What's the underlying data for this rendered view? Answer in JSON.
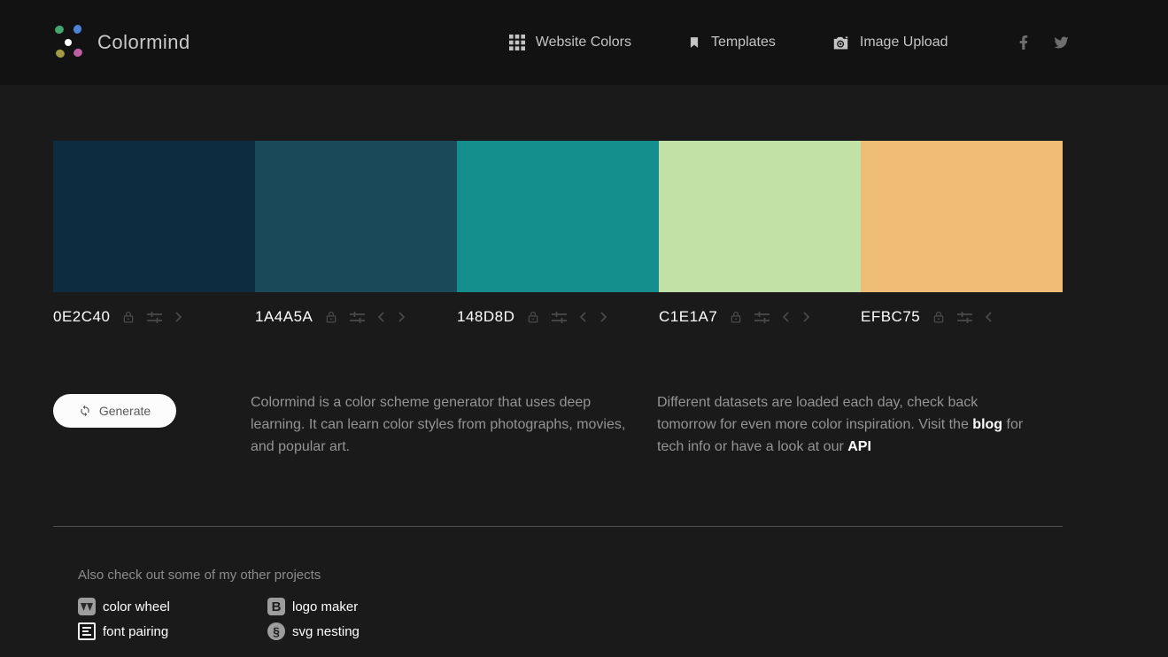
{
  "header": {
    "logo_text": "Colormind",
    "nav": [
      {
        "label": "Website Colors",
        "icon": "grid-icon"
      },
      {
        "label": "Templates",
        "icon": "bookmark-icon"
      },
      {
        "label": "Image Upload",
        "icon": "camera-icon"
      }
    ],
    "social": [
      "facebook-icon",
      "twitter-icon"
    ]
  },
  "brand": {
    "dot_colors": {
      "top_left": "#44a56f",
      "top_right": "#4d82d6",
      "center": "#ffffff",
      "bottom_left": "#a39b44",
      "bottom_right": "#bd5fa0"
    }
  },
  "palette": {
    "swatches": [
      {
        "hex": "0E2C40",
        "color": "#0E2C40"
      },
      {
        "hex": "1A4A5A",
        "color": "#1A4A5A"
      },
      {
        "hex": "148D8D",
        "color": "#148D8D"
      },
      {
        "hex": "C1E1A7",
        "color": "#C1E1A7"
      },
      {
        "hex": "EFBC75",
        "color": "#EFBC75"
      }
    ]
  },
  "actions": {
    "generate_label": "Generate"
  },
  "description": {
    "about": "Colormind is a color scheme generator that uses deep learning. It can learn color styles from photographs, movies, and popular art.",
    "datasets_pre": "Different datasets are loaded each day, check back tomorrow for even more color inspiration. Visit the ",
    "blog_link": "blog",
    "datasets_mid": " for tech info or have a look at our ",
    "api_link": "API"
  },
  "footer": {
    "heading": "Also check out some of my other projects",
    "projects": [
      {
        "label": "color wheel"
      },
      {
        "label": "logo maker",
        "glyph": "B"
      },
      {
        "label": "font pairing"
      },
      {
        "label": "svg nesting",
        "glyph": "§"
      }
    ]
  },
  "ui_colors": {
    "header_bg": "#121212",
    "page_bg": "#1a1a1a",
    "nav_text": "#c4c4c4",
    "swatch_icon": "#4a4a4a",
    "body_text": "#949494",
    "divider": "#4f4f4f"
  }
}
